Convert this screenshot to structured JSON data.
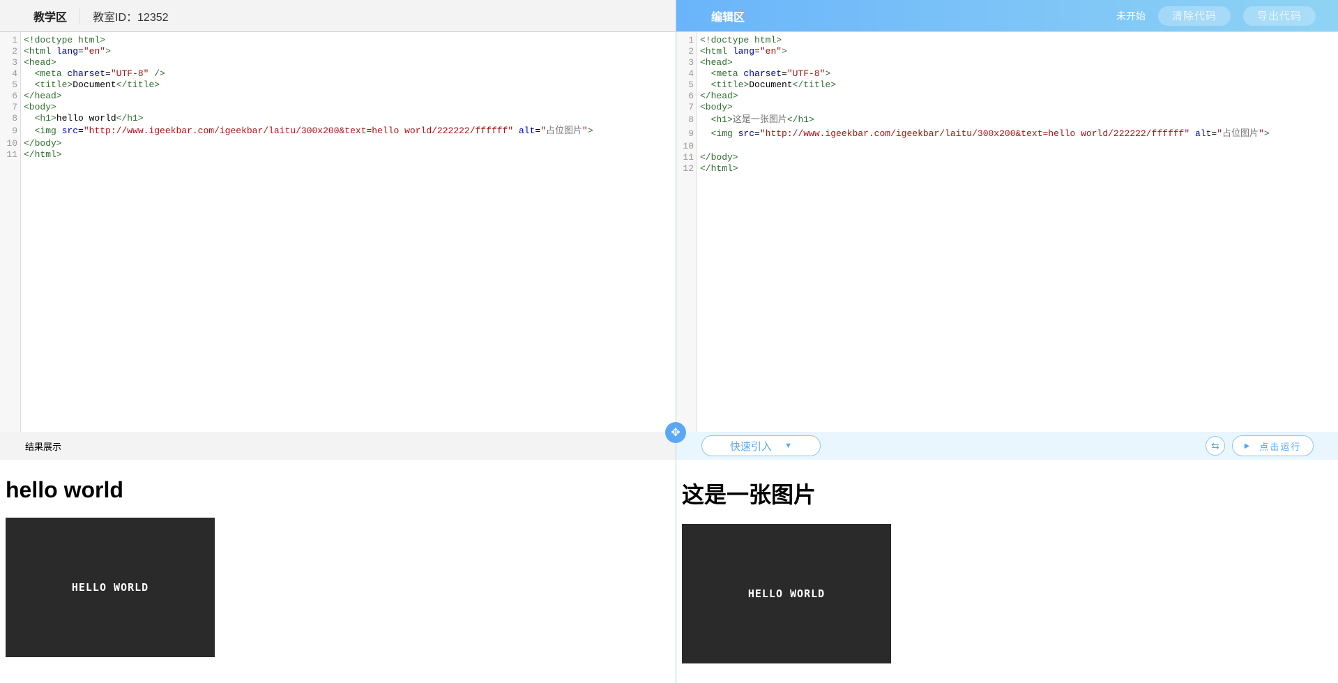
{
  "teaching": {
    "title": "教学区",
    "room_id": "教室ID：12352",
    "result_label": "结果展示",
    "result_heading": "hello world",
    "image_text": "hello world",
    "code": [
      [
        [
          "tag",
          "<!doctype html>"
        ]
      ],
      [
        [
          "tag",
          "<html "
        ],
        [
          "attr",
          "lang"
        ],
        [
          "txt",
          "="
        ],
        [
          "str",
          "\"en\""
        ],
        [
          "tag",
          ">"
        ]
      ],
      [
        [
          "tag",
          "<head>"
        ]
      ],
      [
        [
          "txt",
          "  "
        ],
        [
          "tag",
          "<meta "
        ],
        [
          "attr",
          "charset"
        ],
        [
          "txt",
          "="
        ],
        [
          "str",
          "\"UTF-8\""
        ],
        [
          "tag",
          " />"
        ]
      ],
      [
        [
          "txt",
          "  "
        ],
        [
          "tag",
          "<title>"
        ],
        [
          "txt",
          "Document"
        ],
        [
          "tag",
          "</title>"
        ]
      ],
      [
        [
          "tag",
          "</head>"
        ]
      ],
      [
        [
          "tag",
          "<body>"
        ]
      ],
      [
        [
          "txt",
          "  "
        ],
        [
          "tag",
          "<h1>"
        ],
        [
          "txt",
          "hello world"
        ],
        [
          "tag",
          "</h1>"
        ]
      ],
      [
        [
          "txt",
          "  "
        ],
        [
          "tag",
          "<img "
        ],
        [
          "attr",
          "src"
        ],
        [
          "txt",
          "="
        ],
        [
          "str",
          "\"http://www.igeekbar.com/igeekbar/laitu/300x200&text=hello world/222222/ffffff\""
        ],
        [
          "txt",
          " "
        ],
        [
          "attr",
          "alt"
        ],
        [
          "txt",
          "="
        ],
        [
          "str",
          "\""
        ],
        [
          "cjk",
          "占位图片"
        ],
        [
          "str",
          "\""
        ],
        [
          "tag",
          ">"
        ]
      ],
      [
        [
          "tag",
          "</body>"
        ]
      ],
      [
        [
          "tag",
          "</html>"
        ]
      ]
    ]
  },
  "editing": {
    "title": "编辑区",
    "status": "未开始",
    "clear_label": "清除代码",
    "export_label": "导出代码",
    "quick_import": "快速引入",
    "run_label": "点击运行",
    "result_heading": "这是一张图片",
    "image_text": "hello world",
    "code": [
      [
        [
          "tag",
          "<!doctype html>"
        ]
      ],
      [
        [
          "tag",
          "<html "
        ],
        [
          "attr",
          "lang"
        ],
        [
          "txt",
          "="
        ],
        [
          "str",
          "\"en\""
        ],
        [
          "tag",
          ">"
        ]
      ],
      [
        [
          "tag",
          "<head>"
        ]
      ],
      [
        [
          "txt",
          "  "
        ],
        [
          "tag",
          "<meta "
        ],
        [
          "attr",
          "charset"
        ],
        [
          "txt",
          "="
        ],
        [
          "str",
          "\"UTF-8\""
        ],
        [
          "tag",
          ">"
        ]
      ],
      [
        [
          "txt",
          "  "
        ],
        [
          "tag",
          "<title>"
        ],
        [
          "txt",
          "Document"
        ],
        [
          "tag",
          "</title>"
        ]
      ],
      [
        [
          "tag",
          "</head>"
        ]
      ],
      [
        [
          "tag",
          "<body>"
        ]
      ],
      [
        [
          "txt",
          "  "
        ],
        [
          "tag",
          "<h1>"
        ],
        [
          "cjk",
          "这是一张图片"
        ],
        [
          "tag",
          "</h1>"
        ]
      ],
      [
        [
          "txt",
          "  "
        ],
        [
          "tag",
          "<img "
        ],
        [
          "attr",
          "src"
        ],
        [
          "txt",
          "="
        ],
        [
          "str",
          "\"http://www.igeekbar.com/igeekbar/laitu/300x200&text=hello world/222222/ffffff\""
        ],
        [
          "txt",
          " "
        ],
        [
          "attr",
          "alt"
        ],
        [
          "txt",
          "="
        ],
        [
          "str",
          "\""
        ],
        [
          "cjk",
          "占位图片"
        ],
        [
          "str",
          "\""
        ],
        [
          "tag",
          ">"
        ]
      ],
      [],
      [
        [
          "tag",
          "</body>"
        ]
      ],
      [
        [
          "tag",
          "</html>"
        ]
      ]
    ]
  }
}
